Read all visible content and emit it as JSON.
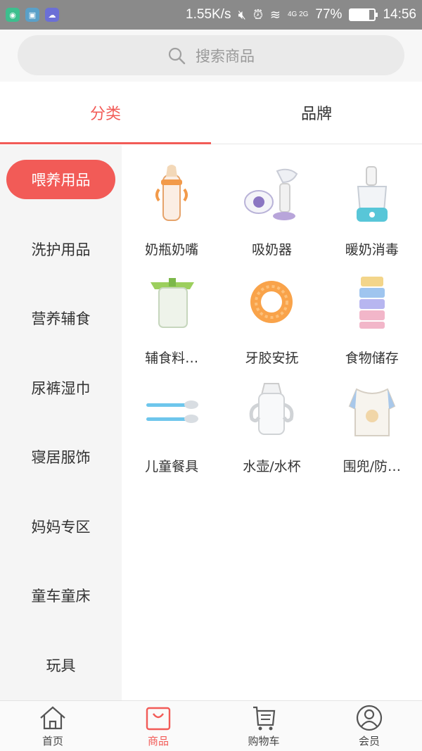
{
  "status_bar": {
    "speed": "1.55K/s",
    "network": "4G 2G",
    "battery": "77%",
    "battery_level": 0.77,
    "time": "14:56"
  },
  "search": {
    "placeholder": "搜索商品"
  },
  "tabs": [
    {
      "label": "分类",
      "active": true
    },
    {
      "label": "品牌",
      "active": false
    }
  ],
  "sidebar": {
    "items": [
      {
        "label": "喂养用品",
        "active": true
      },
      {
        "label": "洗护用品",
        "active": false
      },
      {
        "label": "营养辅食",
        "active": false
      },
      {
        "label": "尿裤湿巾",
        "active": false
      },
      {
        "label": "寝居服饰",
        "active": false
      },
      {
        "label": "妈妈专区",
        "active": false
      },
      {
        "label": "童车童床",
        "active": false
      },
      {
        "label": "玩具",
        "active": false
      }
    ]
  },
  "products": [
    {
      "label": "奶瓶奶嘴",
      "icon": "baby-bottle"
    },
    {
      "label": "吸奶器",
      "icon": "breast-pump"
    },
    {
      "label": "暖奶消毒",
      "icon": "bottle-warmer"
    },
    {
      "label": "辅食料…",
      "icon": "food-masher"
    },
    {
      "label": "牙胶安抚",
      "icon": "teether"
    },
    {
      "label": "食物储存",
      "icon": "milk-powder-container"
    },
    {
      "label": "儿童餐具",
      "icon": "baby-spoons"
    },
    {
      "label": "水壶/水杯",
      "icon": "sippy-cup"
    },
    {
      "label": "围兜/防…",
      "icon": "bib"
    }
  ],
  "bottom_nav": [
    {
      "label": "首页",
      "icon": "home-icon",
      "active": false
    },
    {
      "label": "商品",
      "icon": "bag-icon",
      "active": true
    },
    {
      "label": "购物车",
      "icon": "cart-icon",
      "active": false
    },
    {
      "label": "会员",
      "icon": "user-icon",
      "active": false
    }
  ],
  "colors": {
    "accent": "#f25b57",
    "status_bar": "#8a8a8a"
  }
}
